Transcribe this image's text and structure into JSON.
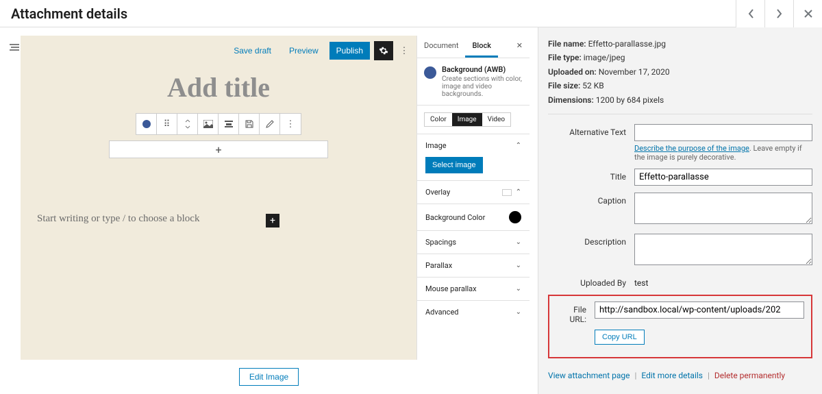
{
  "header": {
    "title": "Attachment details"
  },
  "editor": {
    "topbar": {
      "save_draft": "Save draft",
      "preview": "Preview",
      "publish": "Publish"
    },
    "title_placeholder": "Add title",
    "add_block_prompt": "Start writing or type / to choose a block",
    "edit_image_label": "Edit Image"
  },
  "sidebar": {
    "tabs": {
      "document": "Document",
      "block": "Block"
    },
    "block": {
      "name": "Background (AWB)",
      "desc": "Create sections with color, image and video backgrounds."
    },
    "seg": {
      "color": "Color",
      "image": "Image",
      "video": "Video"
    },
    "panels": {
      "image": "Image",
      "select_image": "Select image",
      "overlay": "Overlay",
      "background_color": "Background Color",
      "spacings": "Spacings",
      "parallax": "Parallax",
      "mouse_parallax": "Mouse parallax",
      "advanced": "Advanced"
    }
  },
  "meta": {
    "file_name_label": "File name:",
    "file_name": "Effetto-parallasse.jpg",
    "file_type_label": "File type:",
    "file_type": "image/jpeg",
    "uploaded_on_label": "Uploaded on:",
    "uploaded_on": "November 17, 2020",
    "file_size_label": "File size:",
    "file_size": "52 KB",
    "dimensions_label": "Dimensions:",
    "dimensions": "1200 by 684 pixels"
  },
  "form": {
    "alt_label": "Alternative Text",
    "alt_value": "",
    "alt_help_link": "Describe the purpose of the image",
    "alt_help_rest": ". Leave empty if the image is purely decorative.",
    "title_label": "Title",
    "title_value": "Effetto-parallasse",
    "caption_label": "Caption",
    "caption_value": "",
    "description_label": "Description",
    "description_value": "",
    "uploaded_by_label": "Uploaded By",
    "uploaded_by_value": "test",
    "file_url_label": "File URL:",
    "file_url_value": "http://sandbox.local/wp-content/uploads/202",
    "copy_url_label": "Copy URL"
  },
  "actions": {
    "view": "View attachment page",
    "edit": "Edit more details",
    "delete": "Delete permanently"
  }
}
